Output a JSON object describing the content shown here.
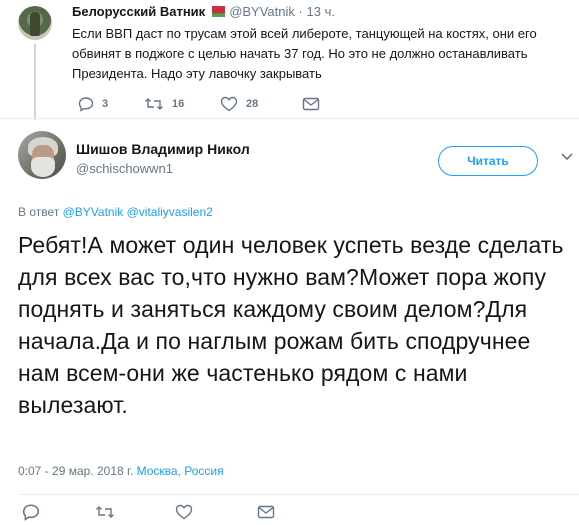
{
  "parent_tweet": {
    "author_name": "Белорусский Ватник",
    "handle": "@BYVatnik",
    "time": "13 ч.",
    "separator": "·",
    "text": "Если ВВП даст по трусам этой всей либероте, танцующей на костях, они его обвинят в поджоге с целью начать 37 год. Но это не должно останавливать Президента. Надо эту лавочку закрывать",
    "replies": "3",
    "retweets": "16",
    "likes": "28"
  },
  "main_tweet": {
    "author_name": "Шишов Владимир Никол",
    "handle": "@schischowwn1",
    "follow_label": "Читать",
    "reply_prefix": "В ответ",
    "reply_to_1": "@BYVatnik",
    "reply_to_2": "@vitaliyvasilen2",
    "text": "Ребят!А может один человек успеть везде сделать для всех вас то,что нужно вам?Может пора жопу поднять и заняться каждому своим делом?Для начала.Да и по наглым рожам бить сподручнее нам всем-они же частенько рядом с нами вылезают.",
    "timestamp": "0:07 - 29 мар. 2018 г.",
    "location": "Москва, Россия"
  },
  "colors": {
    "accent": "#1da1f2",
    "muted": "#657786",
    "text": "#14171a",
    "divider": "#e6ecf0"
  }
}
